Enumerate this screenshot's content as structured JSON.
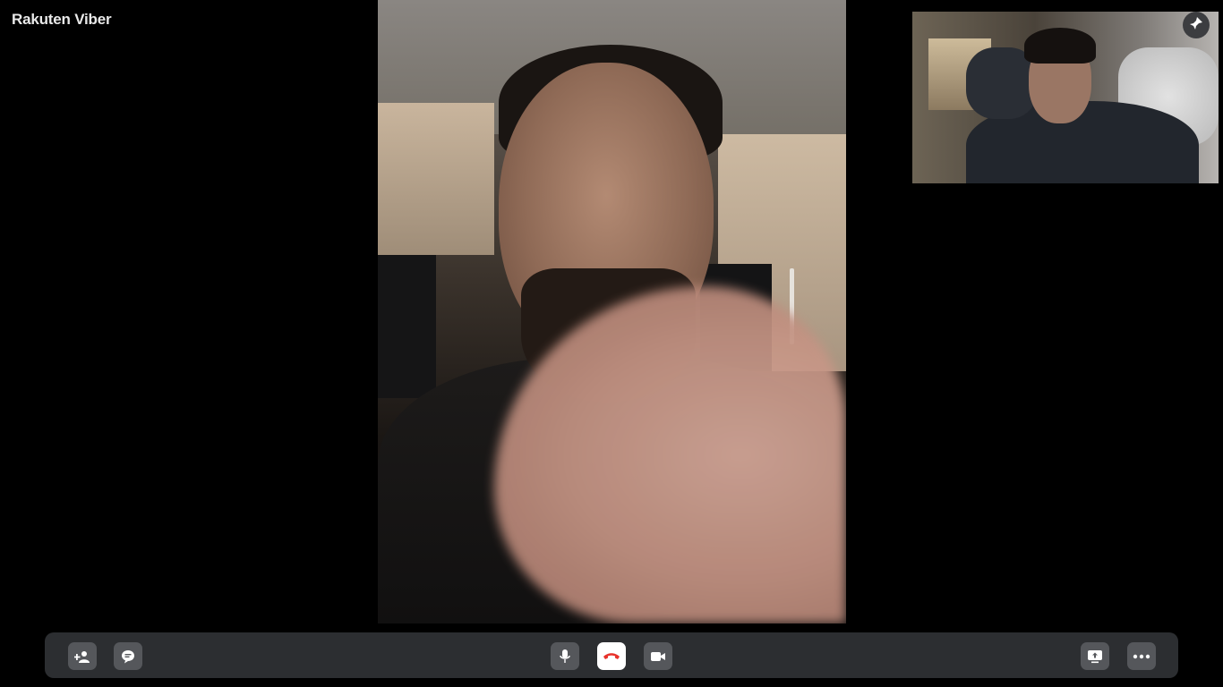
{
  "app": {
    "logo_text": "Rakuten Viber"
  },
  "icons": {
    "pin": "pin-icon",
    "add_participants": "add-participants-icon",
    "chat": "chat-icon",
    "microphone": "microphone-icon",
    "end_call": "end-call-icon",
    "video_camera": "video-camera-icon",
    "screen_share": "screen-share-icon",
    "more": "more-options-icon"
  },
  "colors": {
    "background": "#000000",
    "control_bar": "#2c2e31",
    "button": "#55575b",
    "end_call_button": "#ffffff",
    "end_call_icon": "#e8322b"
  }
}
